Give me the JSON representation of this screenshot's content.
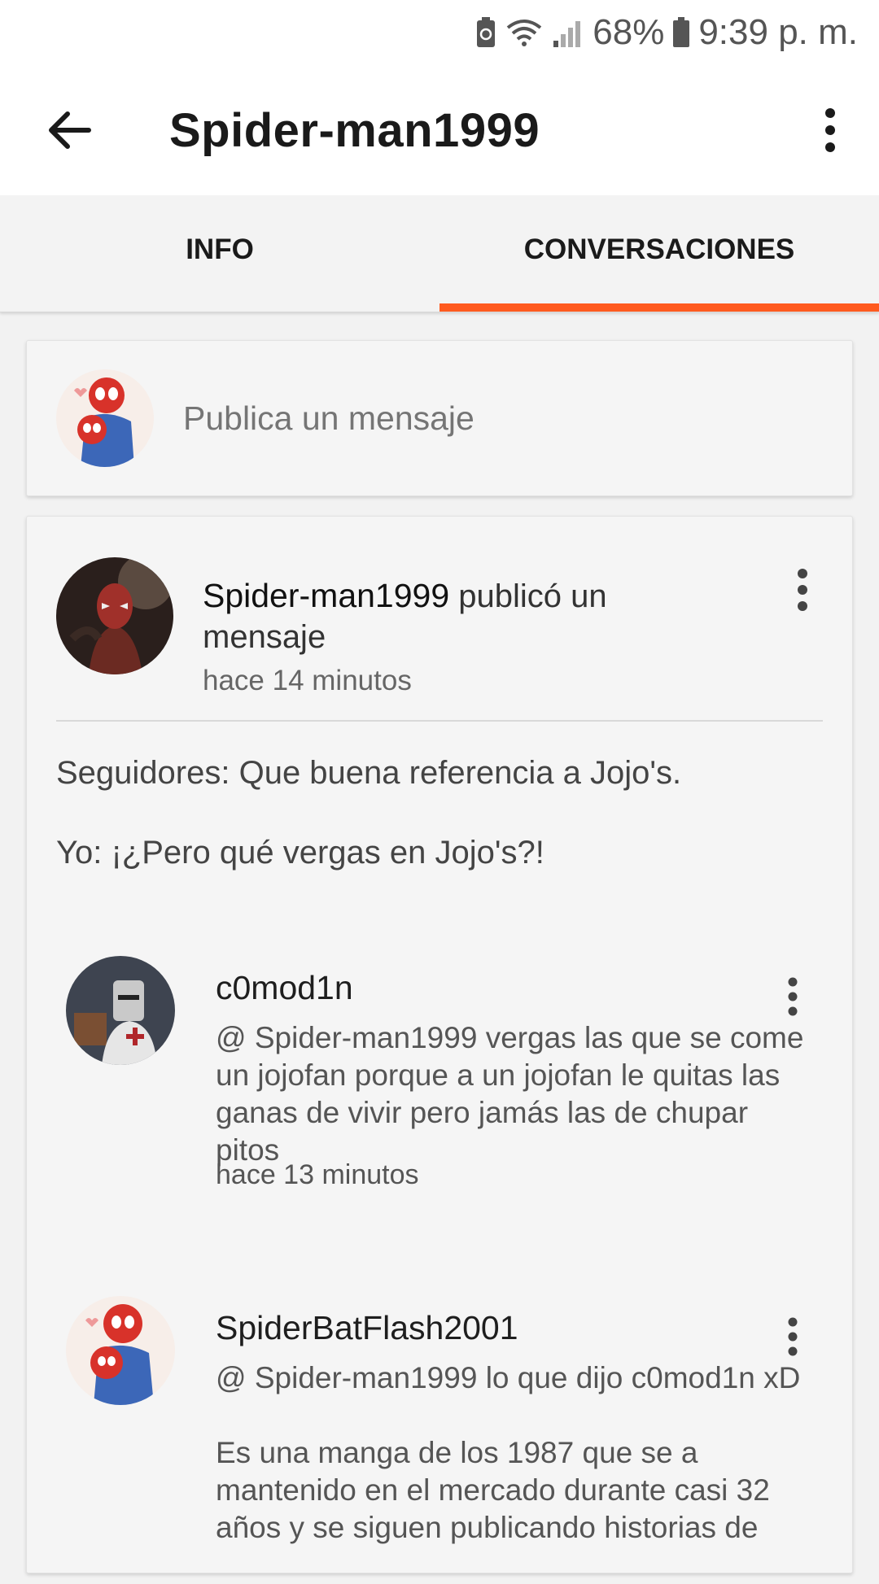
{
  "status_bar": {
    "battery_percent": "68%",
    "time": "9:39 p. m.",
    "icons": [
      "battery-saver-icon",
      "wifi-icon",
      "signal-icon",
      "battery-icon"
    ]
  },
  "app_bar": {
    "title": "Spider-man1999",
    "back_icon": "arrow-left-icon",
    "menu_icon": "more-vertical-icon"
  },
  "tabs": [
    {
      "label": "INFO",
      "active": false
    },
    {
      "label": "CONVERSACIONES",
      "active": true
    }
  ],
  "accent_color": "#ff5a1f",
  "composer": {
    "placeholder": "Publica un mensaje"
  },
  "post": {
    "author": "Spider-man1999",
    "action": "publicó un mensaje",
    "time": "hace 14 minutos",
    "body": [
      "Seguidores: Que buena referencia a Jojo's.",
      "Yo: ¡¿Pero qué vergas en Jojo's?!"
    ]
  },
  "comments": [
    {
      "author": "c0mod1n",
      "mention": "@ Spider-man1999",
      "text": "vergas las que se come un jojofan porque a un jojofan le quitas las ganas de vivir pero jamás las de chupar pitos",
      "time": "hace 13 minutos"
    },
    {
      "author": "SpiderBatFlash2001",
      "mention": "@ Spider-man1999",
      "text": "lo que dijo c0mod1n xD",
      "text_2": "Es una manga de los 1987 que se a mantenido en el mercado durante casi 32 años y se siguen publicando historias de"
    }
  ]
}
